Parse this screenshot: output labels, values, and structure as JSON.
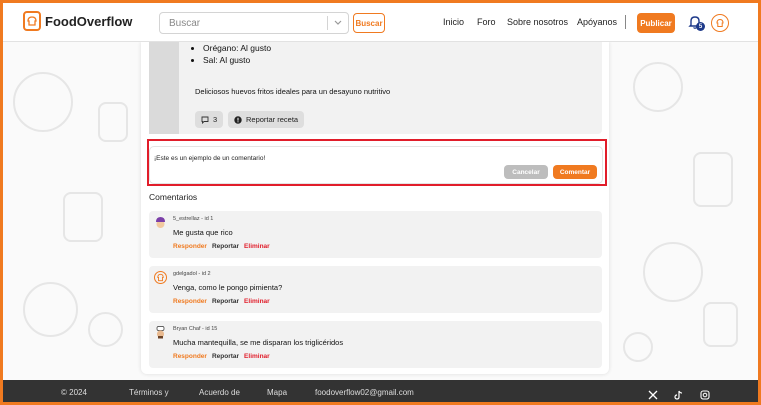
{
  "nav": {
    "brand": "FoodOverflow",
    "search_placeholder": "Buscar",
    "search_button": "Buscar",
    "links": [
      "Inicio",
      "Foro",
      "Sobre nosotros",
      "Apóyanos"
    ],
    "publish_button": "Publicar",
    "notification_count": "5"
  },
  "post": {
    "ingredients": [
      "Orégano: Al gusto",
      "Sal: Al gusto"
    ],
    "description": "Deliciosos huevos fritos ideales para un desayuno nutritivo",
    "comment_count": "3",
    "report_label": "Reportar receta"
  },
  "comment_form": {
    "value": "¡Este es un ejemplo de un comentario!",
    "cancel_label": "Cancelar",
    "submit_label": "Comentar"
  },
  "comments_title": "Comentarios",
  "comments": [
    {
      "author": "5_estrellaz",
      "meta": "5_estrellaz - id 1",
      "text": "Me gusta que rico",
      "avatar": "chef-hat-purple-icon"
    },
    {
      "author": "gdelgadol",
      "meta": "gdelgadol - id 2",
      "text": "Venga, como le pongo pimienta?",
      "avatar": "chef-logo-icon"
    },
    {
      "author": "Bryan Chaf",
      "meta": "Bryan Chaf - id 15",
      "text": "Mucha mantequilla, se me disparan los triglicéridos",
      "avatar": "chef-face-icon"
    }
  ],
  "comment_actions": {
    "reply": "Responder",
    "report": "Reportar",
    "delete": "Eliminar"
  },
  "footer": {
    "copyright": "© 2024",
    "terms": "Términos y",
    "agreement": "Acuerdo de",
    "map": "Mapa",
    "email": "foodoverflow02@gmail.com"
  },
  "colors": {
    "accent": "#f07a20",
    "highlight": "#e11d2a",
    "footer_bg": "#333333"
  }
}
